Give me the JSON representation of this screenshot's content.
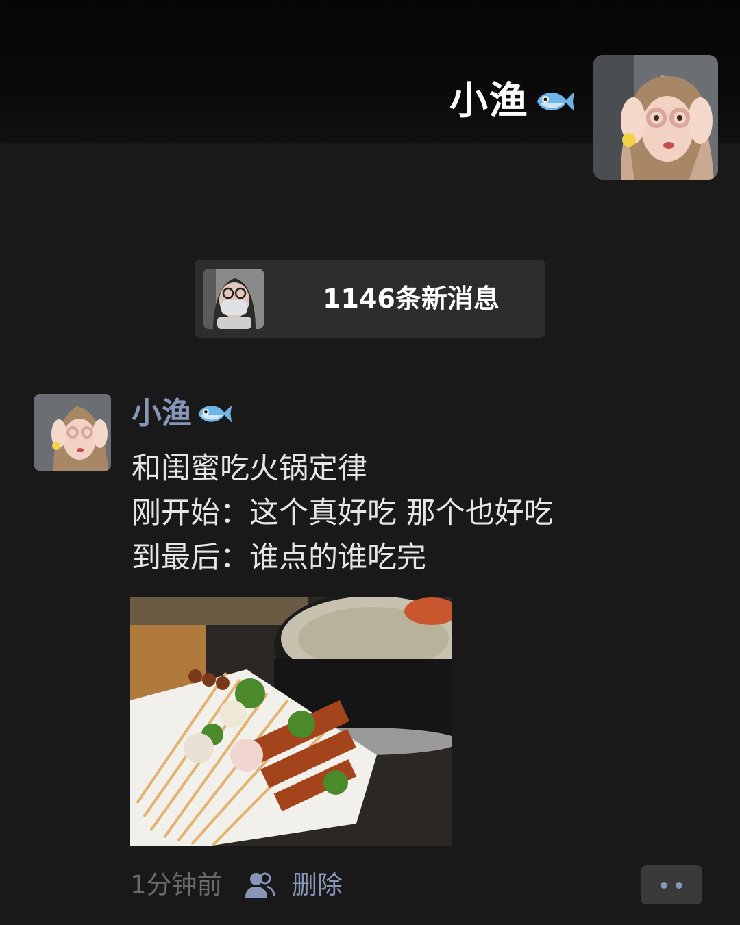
{
  "profile": {
    "name": "小渔",
    "name_icon": "fish-icon"
  },
  "new_messages": {
    "label": "1146条新消息"
  },
  "post": {
    "author": "小渔",
    "author_icon": "fish-icon",
    "lines": [
      "和闺蜜吃火锅定律",
      "刚开始：这个真好吃 那个也好吃",
      "到最后：谁点的谁吃完"
    ],
    "time": "1分钟前",
    "visibility_icon": "people-icon",
    "delete_label": "删除",
    "more_icon": "more-dots-icon"
  }
}
